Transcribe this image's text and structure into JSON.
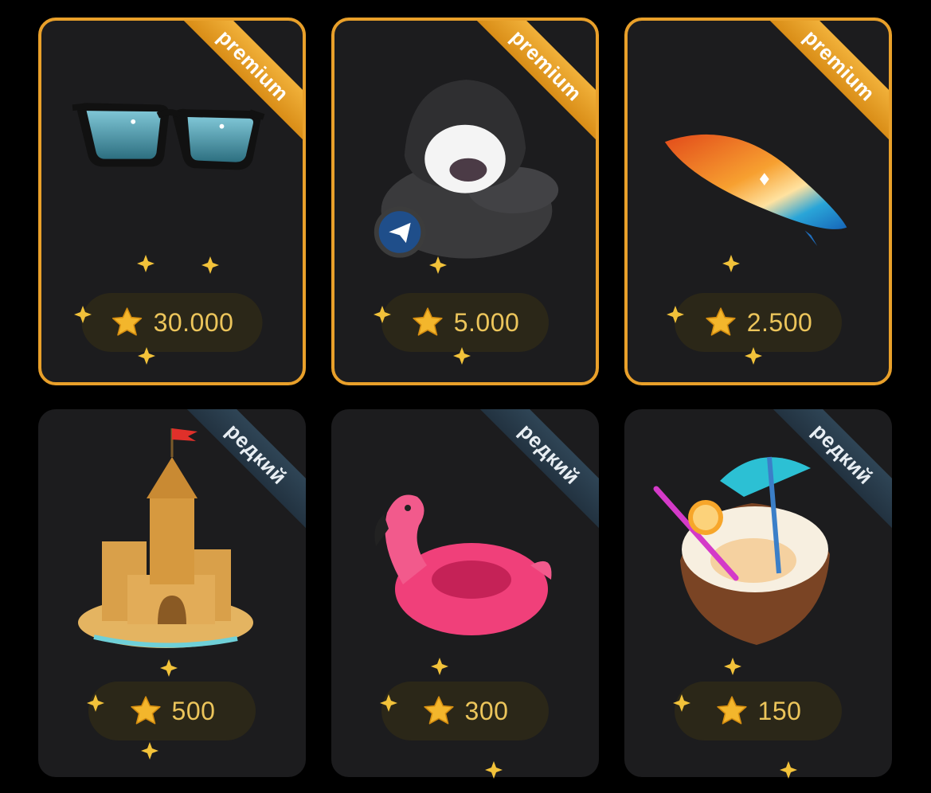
{
  "cards": [
    {
      "badge": "premium",
      "price": "30.000",
      "item": "sunglasses"
    },
    {
      "badge": "premium",
      "price": "5.000",
      "item": "teddy-bear"
    },
    {
      "badge": "premium",
      "price": "2.500",
      "item": "surfboard"
    },
    {
      "badge": "редкий",
      "price": "500",
      "item": "sandcastle"
    },
    {
      "badge": "редкий",
      "price": "300",
      "item": "flamingo-float"
    },
    {
      "badge": "редкий",
      "price": "150",
      "item": "coconut-drink"
    }
  ],
  "colors": {
    "premium": "#e9a02a",
    "rare": "#2f4556",
    "price_text": "#ecc55b",
    "card_bg": "#1c1c1e"
  }
}
